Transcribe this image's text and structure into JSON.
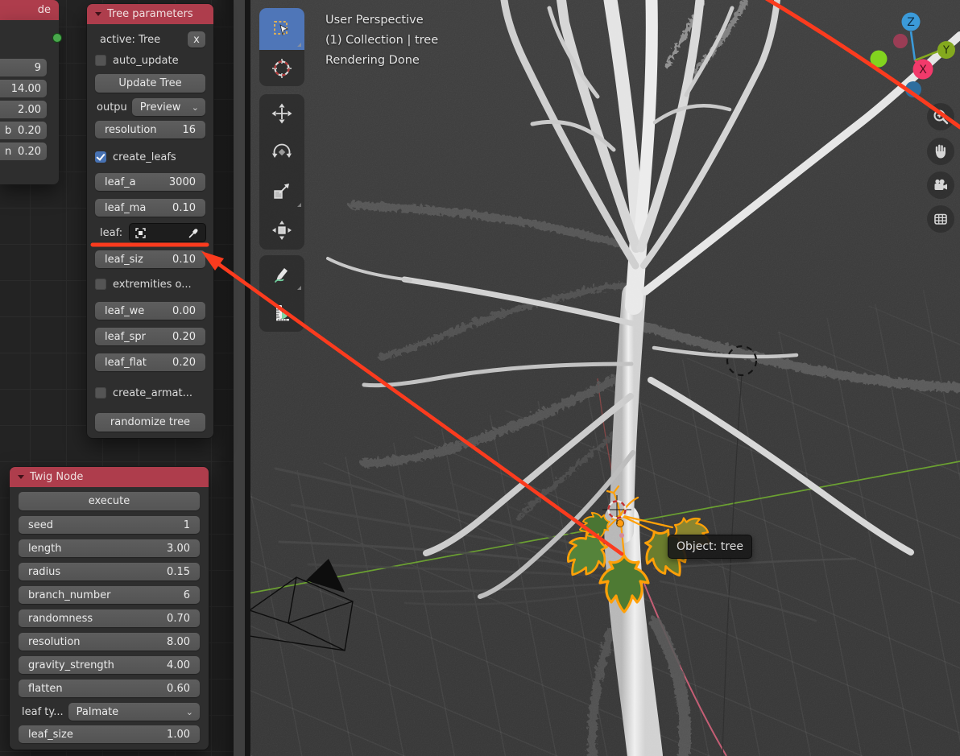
{
  "node_editor": {
    "cut_node": {
      "header_fragment": "de",
      "fields": [
        {
          "label": "",
          "value": "9"
        },
        {
          "label": "",
          "value": "14.00"
        },
        {
          "label": "",
          "value": "2.00"
        },
        {
          "label": "b",
          "value": "0.20"
        },
        {
          "label": "n",
          "value": "0.20"
        }
      ]
    },
    "tree_parameters": {
      "title": "Tree parameters",
      "active": {
        "label": "active: Tree",
        "close": "x"
      },
      "auto_update": {
        "label": "auto_update",
        "checked": false
      },
      "update_button": "Update Tree",
      "output": {
        "label": "outpu",
        "value": "Preview"
      },
      "resolution": {
        "label": "resolution",
        "value": "16"
      },
      "create_leafs": {
        "label": "create_leafs",
        "checked": true
      },
      "leaf_a": {
        "label": "leaf_a",
        "value": "3000"
      },
      "leaf_ma": {
        "label": "leaf_ma",
        "value": "0.10"
      },
      "leaf_picker": {
        "label": "leaf:"
      },
      "leaf_siz": {
        "label": "leaf_siz",
        "value": "0.10"
      },
      "extremities": {
        "label": "extremities o...",
        "checked": false
      },
      "leaf_we": {
        "label": "leaf_we",
        "value": "0.00"
      },
      "leaf_spr": {
        "label": "leaf_spr",
        "value": "0.20"
      },
      "leaf_flat": {
        "label": "leaf_flat",
        "value": "0.20"
      },
      "create_armature": {
        "label": "create_armat...",
        "checked": false
      },
      "randomize_button": "randomize tree"
    },
    "twig_node": {
      "title": "Twig Node",
      "execute_button": "execute",
      "fields": [
        {
          "label": "seed",
          "value": "1"
        },
        {
          "label": "length",
          "value": "3.00"
        },
        {
          "label": "radius",
          "value": "0.15"
        },
        {
          "label": "branch_number",
          "value": "6"
        },
        {
          "label": "randomness",
          "value": "0.70"
        },
        {
          "label": "resolution",
          "value": "8.00"
        },
        {
          "label": "gravity_strength",
          "value": "4.00"
        },
        {
          "label": "flatten",
          "value": "0.60"
        }
      ],
      "leaf_type": {
        "label": "leaf ty...",
        "value": "Palmate"
      },
      "leaf_size": {
        "label": "leaf_size",
        "value": "1.00"
      }
    }
  },
  "viewport": {
    "overlay_lines": [
      "User Perspective",
      "(1) Collection | tree",
      "Rendering Done"
    ],
    "tooltip": "Object: tree",
    "gizmo_axes": {
      "x": "X",
      "y": "Y",
      "z": "Z"
    },
    "toolbar_icon_names": [
      "select-box",
      "cursor",
      "move",
      "rotate",
      "scale",
      "transform",
      "annotate",
      "measure"
    ],
    "nav_icon_names": [
      "zoom",
      "pan-hand",
      "camera",
      "toggle-grid"
    ]
  },
  "colors": {
    "panel_header_red": "#ae3d4c",
    "panel_body": "#2e2e2e",
    "field_gray": "#585858",
    "checkbox_checked_blue": "#4772b3",
    "annotation_orange_red": "#fb3b1e",
    "selection_outline_orange": "#ffa008",
    "axis_green": "#6faa2e",
    "axis_red": "#d4607a",
    "viewport_bg": "#3d3d3d",
    "node_editor_bg": "#232323"
  }
}
